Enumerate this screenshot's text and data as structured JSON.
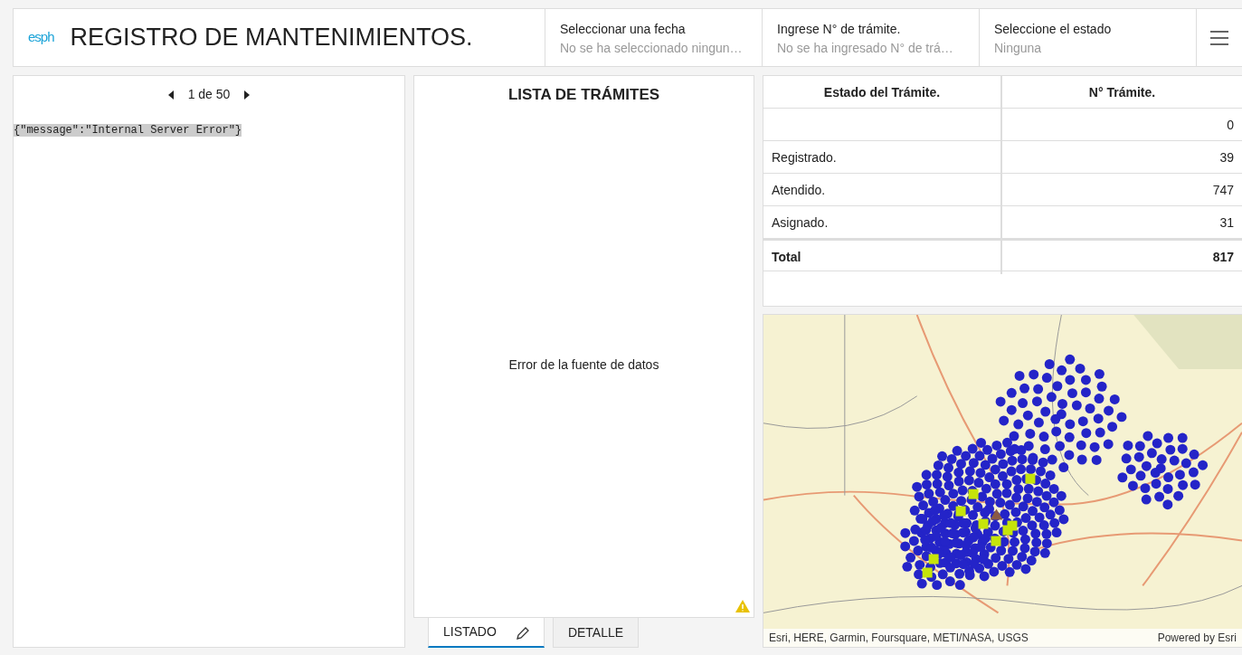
{
  "header": {
    "logo": "esph",
    "title": "REGISTRO DE MANTENIMIENTOS.",
    "filters": [
      {
        "label": "Seleccionar una fecha",
        "value": "No se ha seleccionado ningun…"
      },
      {
        "label": "Ingrese N° de trámite.",
        "value": "No se ha ingresado N° de trá…"
      },
      {
        "label": "Seleccione el estado",
        "value": "Ninguna"
      }
    ]
  },
  "left_panel": {
    "pager": "1 de 50",
    "response": "{\"message\":\"Internal Server Error\"}"
  },
  "list_panel": {
    "title": "LISTA DE TRÁMITES",
    "message": "Error de la fuente de datos",
    "tabs": [
      {
        "label": "LISTADO",
        "selected": true
      },
      {
        "label": "DETALLE",
        "selected": false
      }
    ]
  },
  "table": {
    "columns": [
      "Estado del Trámite.",
      "N° Trámite."
    ],
    "rows": [
      {
        "kind": "row",
        "estado": "",
        "count": "0"
      },
      {
        "kind": "row",
        "estado": "Registrado.",
        "count": "39"
      },
      {
        "kind": "row",
        "estado": "Atendido.",
        "count": "747"
      },
      {
        "kind": "row",
        "estado": "Asignado.",
        "count": "31"
      },
      {
        "kind": "total",
        "estado": "Total",
        "count": "817"
      }
    ]
  },
  "map": {
    "attribution": "Esri, HERE, Garmin, Foursquare, METI/NASA, USGS",
    "powered_by": "Powered by Esri"
  }
}
